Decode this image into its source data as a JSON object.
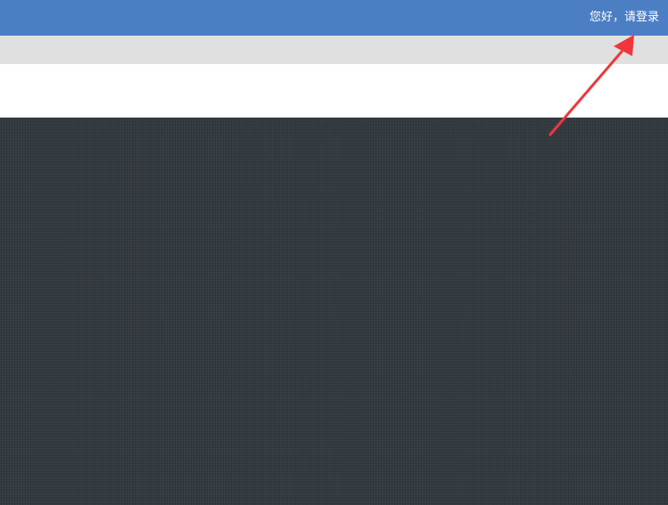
{
  "header": {
    "greeting": "您好，请登录"
  },
  "colors": {
    "top_bar": "#4c7ec4",
    "nav_strip": "#e0e0e0",
    "header_band": "#ffffff",
    "content_background": "#394045",
    "annotation_arrow": "#f0363b"
  },
  "annotation": {
    "icon": "arrow-icon"
  }
}
